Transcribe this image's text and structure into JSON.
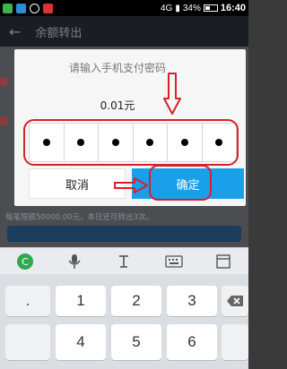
{
  "status_bar": {
    "battery": "34%",
    "time": "16:40",
    "network": "4G"
  },
  "app_bar": {
    "title": "余额转出"
  },
  "background": {
    "limit_note": "每笔限额50000.00元，本日还可转出3次。"
  },
  "dialog": {
    "title": "请输入手机支付密码",
    "amount": "0.01元",
    "pin_dots": [
      "•",
      "•",
      "•",
      "•",
      "•",
      "•"
    ],
    "cancel_label": "取消",
    "confirm_label": "确定"
  },
  "annotation_color": "#d8202a",
  "accent_color": "#1aa0ea",
  "keyboard": {
    "toolbar_icons": [
      "app-logo-icon",
      "microphone-icon",
      "text-cursor-icon",
      "keyboard-icon",
      "window-icon"
    ],
    "row1": [
      ".",
      "1",
      "2",
      "3"
    ],
    "row2": [
      "",
      "4",
      "5",
      "6"
    ]
  }
}
